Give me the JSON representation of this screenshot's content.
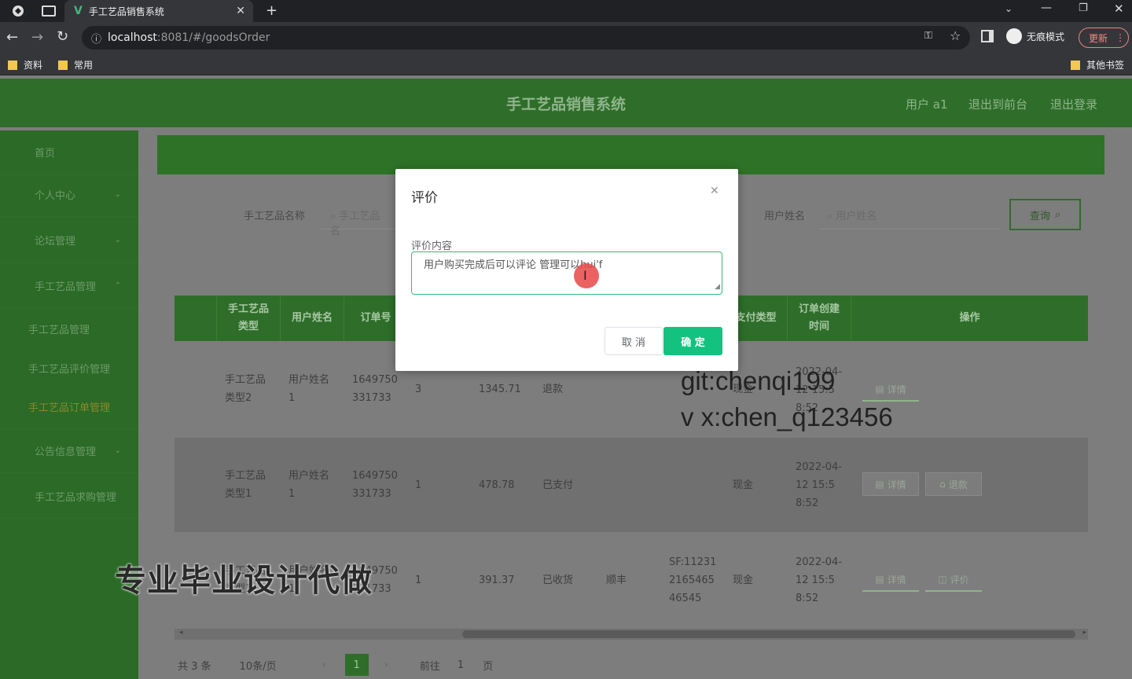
{
  "browser": {
    "tab_title": "手工艺品销售系统",
    "url_host": "localhost",
    "url_rest": ":8081/#/goodsOrder",
    "incognito_label": "无痕模式",
    "update_label": "更新",
    "bookmarks": [
      "资料",
      "常用"
    ],
    "other_bookmarks": "其他书签"
  },
  "header": {
    "title": "手工艺品销售系统",
    "user": "用户 a1",
    "back_front": "退出到前台",
    "logout": "退出登录"
  },
  "sidebar": {
    "items": [
      {
        "label": "首页"
      },
      {
        "label": "个人中心"
      },
      {
        "label": "论坛管理"
      },
      {
        "label": "手工艺品管理"
      },
      {
        "label": "手工艺品管理"
      },
      {
        "label": "手工艺品评价管理"
      },
      {
        "label": "手工艺品订单管理"
      },
      {
        "label": "公告信息管理"
      },
      {
        "label": "手工艺品求购管理"
      }
    ]
  },
  "search": {
    "name_label": "手工艺品名称",
    "name_placeholder": "手工艺品名",
    "user_label": "用户姓名",
    "user_placeholder": "用户姓名",
    "query_button": "查询"
  },
  "table": {
    "headers": [
      "手工艺品类型",
      "用户姓名",
      "订单号",
      "支付类型",
      "订单创建时间",
      "操作"
    ],
    "rows": [
      {
        "type": "手工艺品类型2",
        "user": "用户姓名1",
        "order_no": "1649750331733",
        "qty": "3",
        "price": "1345.71",
        "status": "退款",
        "courier": "",
        "tracking": "",
        "pay": "现金",
        "time": "2022-04-12 15:58:52",
        "actions": [
          "详情"
        ]
      },
      {
        "type": "手工艺品类型1",
        "user": "用户姓名1",
        "order_no": "1649750331733",
        "qty": "1",
        "price": "478.78",
        "status": "已支付",
        "courier": "",
        "tracking": "",
        "pay": "现金",
        "time": "2022-04-12 15:58:52",
        "actions": [
          "详情",
          "退款"
        ]
      },
      {
        "type": "手工艺品类型1",
        "user": "用户姓名1",
        "order_no": "1649750331733",
        "qty": "1",
        "price": "391.37",
        "status": "已收货",
        "courier": "顺丰",
        "tracking": "SF:11231216546546545",
        "pay": "现金",
        "time": "2022-04-12 15:58:52",
        "actions": [
          "详情",
          "评价"
        ]
      }
    ]
  },
  "pagination": {
    "total": "共 3 条",
    "page_size": "10条/页",
    "current": "1",
    "goto": "前往",
    "goto_value": "1",
    "page_suffix": "页"
  },
  "modal": {
    "title": "评价",
    "field_label": "评价内容",
    "field_value": "用户购买完成后可以评论  管理可以hui'f",
    "cancel": "取 消",
    "confirm": "确 定"
  },
  "overlays": {
    "watermark_line1": "git:chenqi199",
    "watermark_line2": "v x:chen_q123456",
    "banner": "专业毕业设计代做"
  }
}
